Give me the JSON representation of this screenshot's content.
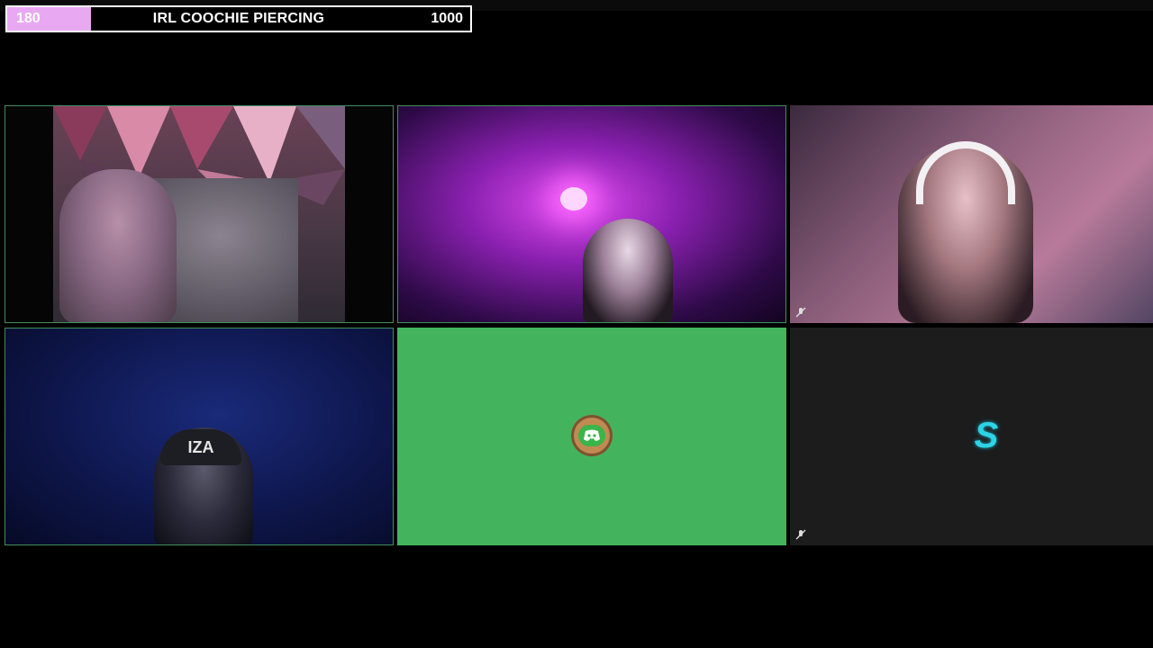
{
  "goal": {
    "current": "180",
    "title": "IRL COOCHIE PIERCING",
    "target": "1000",
    "progress_fraction": 0.18,
    "fill_color": "#e9a8f2"
  },
  "tiles": [
    {
      "id": "participant-1",
      "kind": "camera",
      "muted": false
    },
    {
      "id": "participant-2",
      "kind": "camera",
      "muted": false
    },
    {
      "id": "participant-3",
      "kind": "camera",
      "muted": true
    },
    {
      "id": "participant-4",
      "kind": "camera",
      "muted": false
    },
    {
      "id": "participant-5",
      "kind": "avatar",
      "icon": "discord-icon",
      "background": "#43b45d",
      "muted": false
    },
    {
      "id": "participant-6",
      "kind": "avatar",
      "logo_text": "S",
      "background": "#1c1c1c",
      "muted": true
    }
  ],
  "colors": {
    "tile_border": "#3f8f5c",
    "accent_cyan": "#2ed3e6"
  },
  "hat_text": "IZA"
}
